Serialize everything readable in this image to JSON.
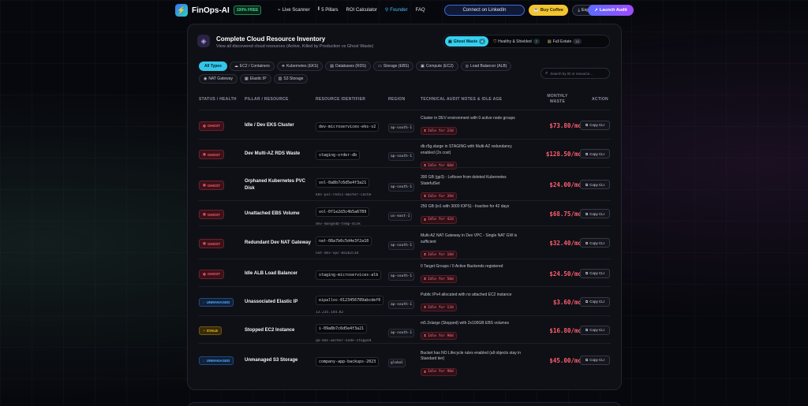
{
  "nav": {
    "brand": "FinOps-AI",
    "badge": "100% FREE",
    "menu": [
      {
        "label": "Live Scanner",
        "icon": "pulse-icon",
        "glyph": "⌁"
      },
      {
        "label": "5 Pillars",
        "icon": "columns-icon",
        "glyph": "⫴"
      },
      {
        "label": "ROI Calculator",
        "icon": "",
        "glyph": ""
      },
      {
        "label": "Founder",
        "icon": "user-icon",
        "glyph": "⚲"
      },
      {
        "label": "FAQ",
        "icon": "",
        "glyph": ""
      }
    ],
    "linkedin": "Connect on LinkedIn",
    "coffee": "Buy Coffee",
    "export": "Export",
    "launch": "Launch Audit"
  },
  "panel": {
    "title": "Complete Cloud Resource Inventory",
    "subtitle": "View all discovered cloud resources (Active, Killed by Production vs Ghost Waste)",
    "segments": [
      {
        "label": "Ghost Waste",
        "count": "6"
      },
      {
        "label": "Healthy & Shielded",
        "count": "7"
      },
      {
        "label": "Full Estate",
        "count": "15"
      }
    ],
    "filters": [
      {
        "label": "All Types",
        "icon": ""
      },
      {
        "label": "EC2 / Containers",
        "icon": "☁"
      },
      {
        "label": "Kubernetes (EKS)",
        "icon": "⎈"
      },
      {
        "label": "Databases (RDS)",
        "icon": "▤"
      },
      {
        "label": "Storage (EBS)",
        "icon": "▭"
      },
      {
        "label": "Compute (EC2)",
        "icon": "▣"
      },
      {
        "label": "Load Balancer (ALB)",
        "icon": "◎"
      },
      {
        "label": "NAT Gateway",
        "icon": "◉"
      },
      {
        "label": "Elastic IP",
        "icon": "▦"
      },
      {
        "label": "S3 Storage",
        "icon": "▥"
      }
    ],
    "search_placeholder": "Search by ID or resource..."
  },
  "table": {
    "headers": {
      "status": "STATUS / HEALTH",
      "pillar": "PILLAR / RESOURCE",
      "identifier": "RESOURCE IDENTIFIER",
      "region": "REGION",
      "notes": "TECHNICAL AUDIT NOTES & IDLE AGE",
      "waste": "MONTHLY WASTE",
      "action": "ACTION"
    },
    "copy_label": "Copy CLI",
    "rows": [
      {
        "status": "GHOST",
        "kind": "ghost",
        "name": "Idle / Dev EKS Cluster",
        "id": "dev-microservices-eks-v2",
        "sub": "",
        "region": "ap-south-1",
        "note": "Cluster in DEV environment with 0 active node groups",
        "idle": "Idle for 23d",
        "waste": "$73.80/mo"
      },
      {
        "status": "GHOST",
        "kind": "ghost",
        "name": "Dev Multi-AZ RDS Waste",
        "id": "staging-order-db",
        "sub": "",
        "region": "ap-south-1",
        "note": "db.r5g.xlarge in STAGING with Multi-AZ redundancy enabled (2x cost)",
        "idle": "Idle for 60d",
        "waste": "$128.50/mo"
      },
      {
        "status": "GHOST",
        "kind": "ghost",
        "name": "Orphaned Kubernetes PVC Disk",
        "id": "vol-0a8b7c6d5e4f3a21",
        "sub": "k8s-pvc-redis-master-cache",
        "region": "ap-south-1",
        "note": "300 GB (gp3) - Leftover from deleted Kubernetes StatefulSet",
        "idle": "Idle for 39d",
        "waste": "$24.00/mo"
      },
      {
        "status": "GHOST",
        "kind": "ghost",
        "name": "Unattached EBS Volume",
        "id": "vol-0f1e2d3c4b5a6789",
        "sub": "dev-mongodb-temp-disk",
        "region": "us-east-1",
        "note": "250 GB (io1 with 3000 IOPS) - Inactive for 42 days",
        "idle": "Idle for 42d",
        "waste": "$68.75/mo"
      },
      {
        "status": "GHOST",
        "kind": "ghost",
        "name": "Redundant Dev NAT Gateway",
        "id": "nat-08a7b6c5d4e3f2a10",
        "sub": "nat-dev-vpc-8a1b2c3d",
        "region": "ap-south-1",
        "note": "Multi-AZ NAT Gateway in Dev VPC - Single NAT GW is sufficient",
        "idle": "Idle for 18d",
        "waste": "$32.40/mo"
      },
      {
        "status": "GHOST",
        "kind": "ghost",
        "name": "Idle ALB Load Balancer",
        "id": "staging-microservices-alb",
        "sub": "",
        "region": "ap-south-1",
        "note": "0 Target Groups / 0 Active Backends registered",
        "idle": "Idle for 50d",
        "waste": "$24.50/mo"
      },
      {
        "status": "UNMANAGED",
        "kind": "unmanaged",
        "name": "Unassociated Elastic IP",
        "id": "eipalloc-0123456789abcdef0",
        "sub": "13.235.144.82",
        "region": "ap-south-1",
        "note": "Public IPv4 allocated with no attached EC2 instance",
        "idle": "Idle for 13d",
        "waste": "$3.60/mo"
      },
      {
        "status": "STALE",
        "kind": "stale",
        "name": "Stopped EC2 Instance",
        "id": "i-09a8b7c6d5e4f3a21",
        "sub": "qa-k8s-worker-node-stopped",
        "region": "ap-south-1",
        "note": "m5.2xlarge (Stopped) with 2x100GB EBS volumes",
        "idle": "Idle for 90d",
        "waste": "$16.80/mo"
      },
      {
        "status": "UNMANAGED",
        "kind": "unmanaged",
        "name": "Unmanaged S3 Storage",
        "id": "company-app-backups-2023",
        "sub": "",
        "region": "global",
        "note": "Bucket has NO Lifecycle rules enabled (all objects stay in Standard tier)",
        "idle": "Idle for 90d",
        "waste": "$45.00/mo"
      }
    ]
  }
}
